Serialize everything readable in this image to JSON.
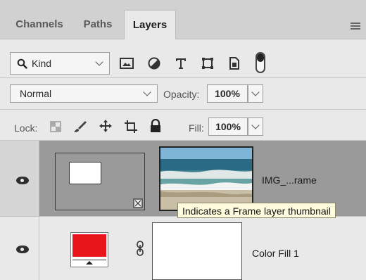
{
  "tabs": [
    {
      "label": "Channels"
    },
    {
      "label": "Paths"
    },
    {
      "label": "Layers"
    }
  ],
  "filter": {
    "kind_label": "Kind"
  },
  "blend": {
    "mode": "Normal",
    "opacity_label": "Opacity:",
    "opacity_value": "100%"
  },
  "lock": {
    "label": "Lock:",
    "fill_label": "Fill:",
    "fill_value": "100%"
  },
  "layers": [
    {
      "name": "IMG_...rame"
    },
    {
      "name": "Color Fill 1",
      "swatch_color": "#e8161b"
    }
  ],
  "tooltip": {
    "text": "Indicates a Frame layer thumbnail"
  }
}
